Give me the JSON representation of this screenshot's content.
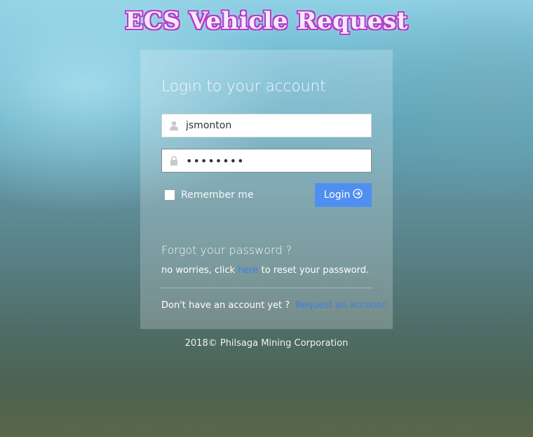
{
  "page": {
    "title": "ECS Vehicle Request"
  },
  "login": {
    "heading": "Login to your account",
    "username_value": "jsmonton",
    "username_icon": "user-icon",
    "password_value": "••••••••",
    "password_icon": "lock-icon",
    "remember_label": "Remember me",
    "remember_checked": false,
    "login_button_label": "Login",
    "login_button_icon": "arrow-circle-right-icon",
    "accent_color": "#4f8ff0"
  },
  "forgot": {
    "title": "Forgot your password ?",
    "text_before": "no worries, click ",
    "link_text": "here",
    "text_after": " to reset your password."
  },
  "signup": {
    "text": "Don't have an account yet ?",
    "link_text": "Request an account"
  },
  "footer": {
    "text": "2018© Philsaga Mining Corporation"
  }
}
